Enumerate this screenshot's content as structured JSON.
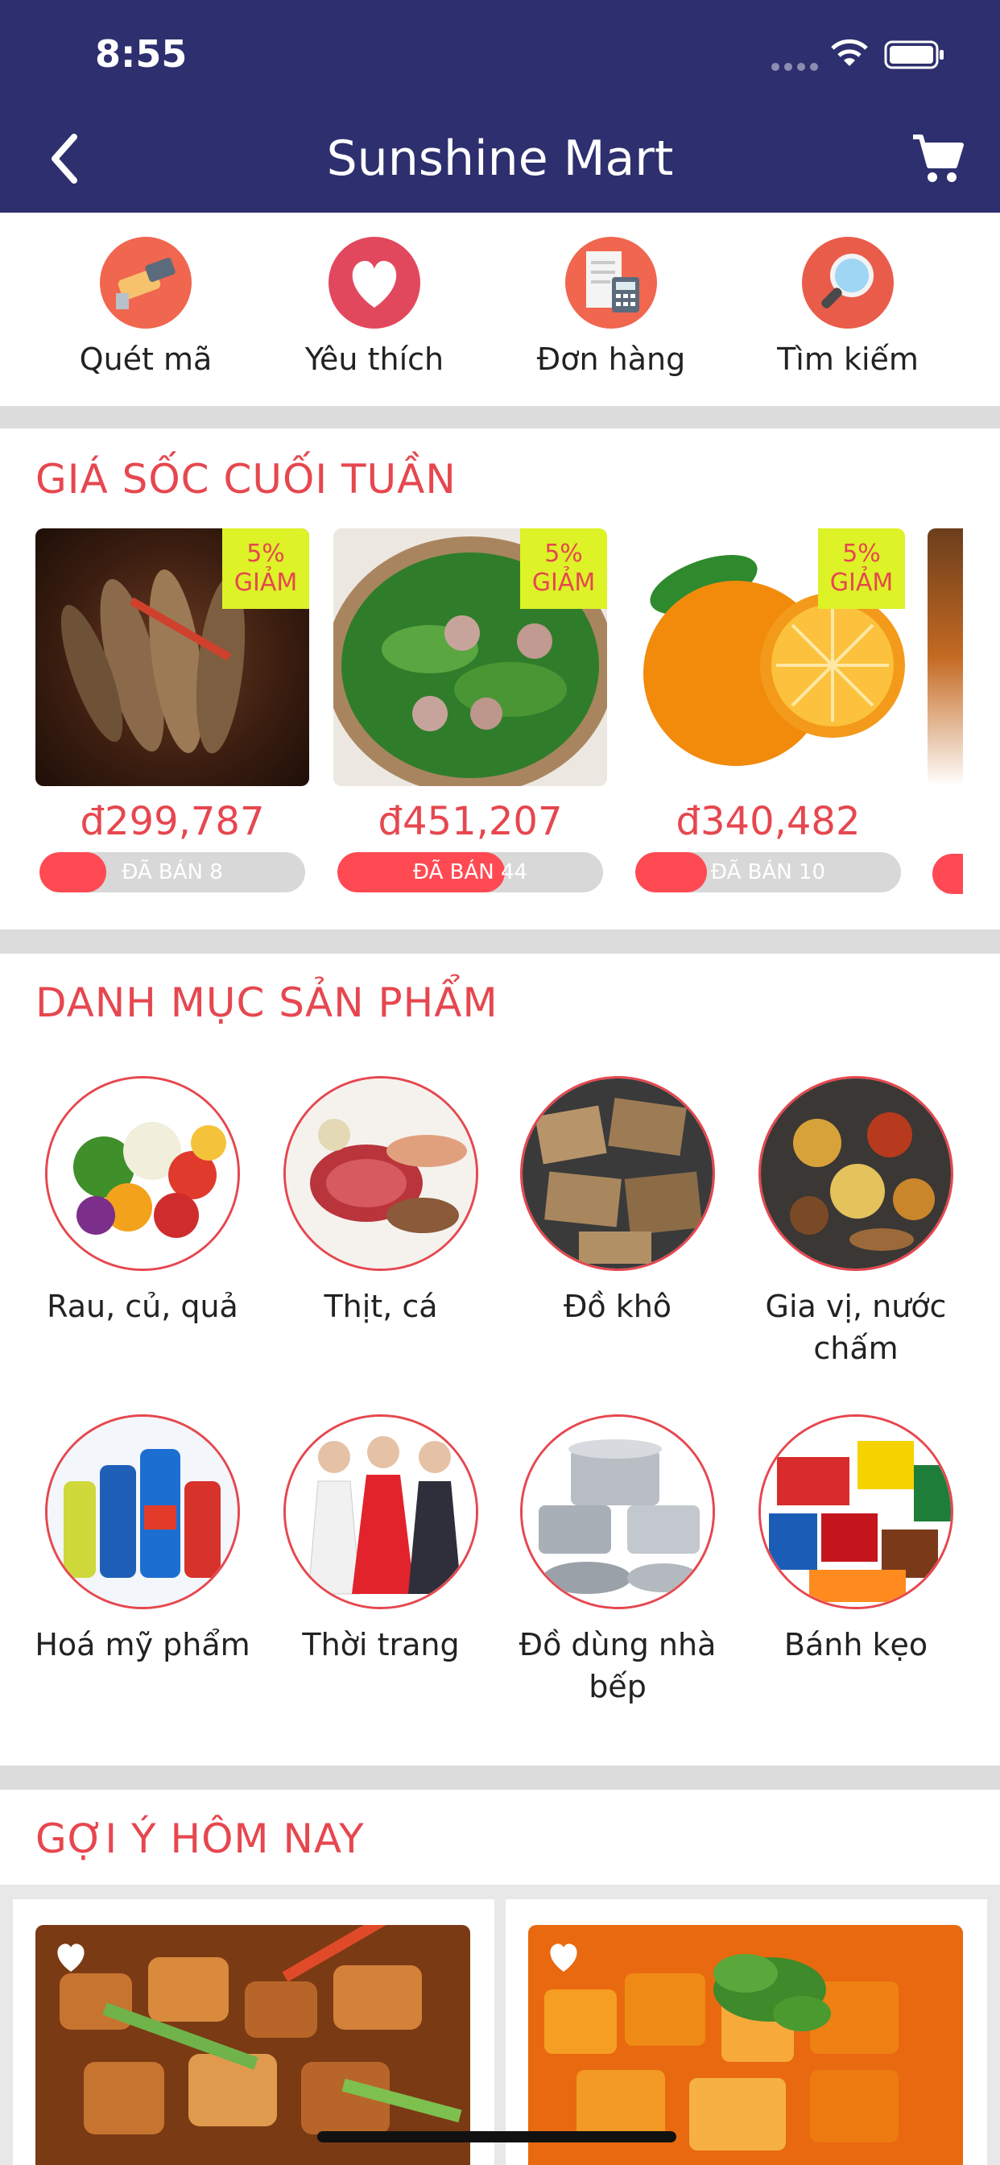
{
  "status_bar": {
    "time": "8:55"
  },
  "nav": {
    "title": "Sunshine Mart",
    "back_icon": "chevron-left-icon",
    "cart_icon": "cart-icon"
  },
  "quick_actions": [
    {
      "label": "Quét mã",
      "icon": "barcode-scan-icon"
    },
    {
      "label": "Yêu thích",
      "icon": "heart-icon"
    },
    {
      "label": "Đơn hàng",
      "icon": "receipt-calculator-icon"
    },
    {
      "label": "Tìm kiếm",
      "icon": "magnifier-icon"
    }
  ],
  "flash_sale": {
    "title": "GIÁ SỐC CUỐI TUẦN",
    "items": [
      {
        "discount": "5%",
        "discount_label": "GIẢM",
        "price": "đ299,787",
        "sold": "ĐÃ BÁN 8",
        "sold_fraction": 0.25
      },
      {
        "discount": "5%",
        "discount_label": "GIẢM",
        "price": "đ451,207",
        "sold": "ĐÃ BÁN 44",
        "sold_fraction": 0.63
      },
      {
        "discount": "5%",
        "discount_label": "GIẢM",
        "price": "đ340,482",
        "sold": "ĐÃ BÁN 10",
        "sold_fraction": 0.27
      }
    ]
  },
  "categories": {
    "title": "DANH MỤC SẢN PHẨM",
    "items": [
      {
        "label": "Rau, củ, quả"
      },
      {
        "label": "Thịt, cá"
      },
      {
        "label": "Đồ khô"
      },
      {
        "label": "Gia vị, nước chấm"
      },
      {
        "label": "Hoá mỹ phẩm"
      },
      {
        "label": "Thời trang"
      },
      {
        "label": "Đồ dùng nhà bếp"
      },
      {
        "label": "Bánh kẹo"
      }
    ]
  },
  "suggestions": {
    "title": "GỢI Ý HÔM NAY"
  },
  "colors": {
    "header": "#2e2f6e",
    "accent": "#e6474f",
    "badge": "#ddf227",
    "progress": "#ff4a53"
  }
}
